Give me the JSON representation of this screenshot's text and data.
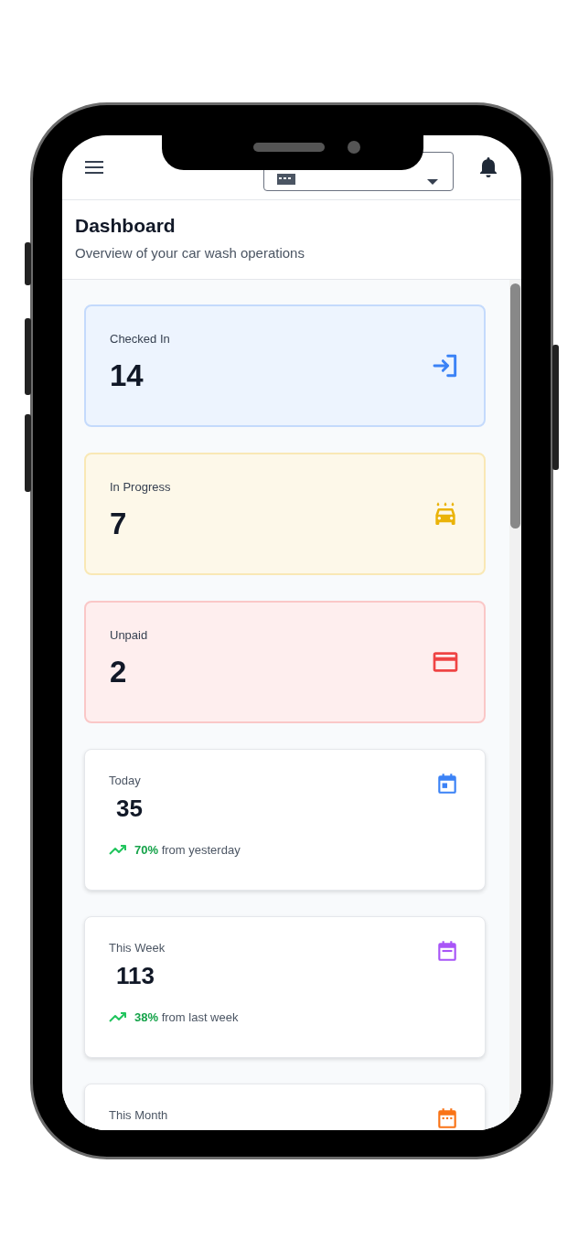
{
  "page": {
    "title": "Dashboard",
    "subtitle": "Overview of your car wash operations"
  },
  "status_cards": [
    {
      "label": "Checked In",
      "value": "14",
      "color": "#3b82f6",
      "kind": "login"
    },
    {
      "label": "In Progress",
      "value": "7",
      "color": "#eab308",
      "kind": "car_wash"
    },
    {
      "label": "Unpaid",
      "value": "2",
      "color": "#ef4444",
      "kind": "card"
    }
  ],
  "stat_cards": [
    {
      "label": "Today",
      "value": "35",
      "change": "70%",
      "change_text": "from yesterday",
      "color": "#3b82f6",
      "kind": "day"
    },
    {
      "label": "This Week",
      "value": "113",
      "change": "38%",
      "change_text": "from last week",
      "color": "#a855f7",
      "kind": "week"
    },
    {
      "label": "This Month",
      "color": "#f97316",
      "kind": "month"
    }
  ]
}
